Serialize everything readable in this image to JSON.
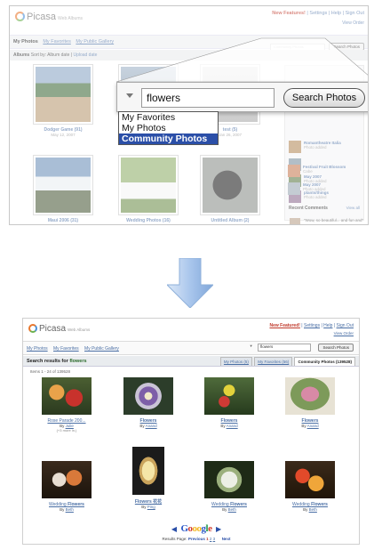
{
  "top": {
    "logo_text": "Picasa",
    "logo_sub": "Web Albums",
    "top_links": [
      "New Features!",
      "Settings",
      "Help",
      "Sign Out"
    ],
    "view_order": "View Order",
    "nav_current": "My Photos",
    "nav_links": [
      "My Favorites",
      "My Public Gallery"
    ],
    "search_placeholder": "Community Photos",
    "search_button": "Search Photos",
    "sort_prefix": "Albums",
    "sort_label": "Sort by: Album date",
    "sort_link": "Upload date",
    "albums": [
      {
        "title": "Dodger Game",
        "count": "(91)",
        "date": "May 12, 2007"
      },
      {
        "title": "",
        "count": "",
        "date": ""
      },
      {
        "title": "test",
        "count": "(5)",
        "date": "Jan 26, 2007"
      },
      {
        "title": "Maui 2006",
        "count": "(31)",
        "date": ""
      },
      {
        "title": "Wedding Photos",
        "count": "(16)",
        "date": ""
      },
      {
        "title": "Untitled Album",
        "count": "(2)",
        "date": ""
      }
    ],
    "sidebar_items": [
      {
        "name": "Romantheatre Italia",
        "meta": "Photo added"
      },
      {
        "name": "",
        "meta": ""
      },
      {
        "name": "May 2007",
        "meta": "Photo added"
      },
      {
        "name": "plants/things",
        "meta": "Photo added"
      },
      {
        "name": "Festival Fruit Blossom",
        "meta": "Cabe"
      },
      {
        "name": "May 2007",
        "meta": "Photo added"
      }
    ],
    "recent_comments_label": "Recent Comments",
    "recent_comments_link": "View all",
    "recent_comment_text": "\"Wow, so beautiful... and fun and\""
  },
  "zoom": {
    "query": "flowers",
    "button": "Search Photos",
    "dropdown_options": [
      "My Favorites",
      "My Photos",
      "Community Photos"
    ],
    "dropdown_selected": "Community Photos"
  },
  "bottom": {
    "logo_text": "Picasa",
    "logo_sub": "Web Albums",
    "top_links": [
      "New Featured!",
      "Settings",
      "Help",
      "Sign Out"
    ],
    "view_order": "View Order",
    "nav_links": [
      "My Photos",
      "My Favorites",
      "My Public Gallery"
    ],
    "search_value": "flowers",
    "search_button": "Search Photos",
    "results_title_prefix": "Search results for",
    "results_query": "flowers",
    "tabs": [
      {
        "label": "My Photos (5)",
        "active": false
      },
      {
        "label": "My Favorites (56)",
        "active": false
      },
      {
        "label": "Community Photos (139528)",
        "active": true
      }
    ],
    "items_range": "Items 1 - 24 of 139528",
    "results": [
      {
        "name_plain": "Rose Parade 200...",
        "name_bold": "",
        "by_prefix": "By",
        "author": "Julie",
        "extra": "(+3 more in.)"
      },
      {
        "name_plain": "",
        "name_bold": "Flowers",
        "by_prefix": "By",
        "author": "Anand",
        "extra": ""
      },
      {
        "name_plain": "",
        "name_bold": "Flowers",
        "by_prefix": "By",
        "author": "Anand",
        "extra": ""
      },
      {
        "name_plain": "",
        "name_bold": "Flowers",
        "by_prefix": "By",
        "author": "Anand",
        "extra": ""
      },
      {
        "name_plain": "Wedding ",
        "name_bold": "Flowers",
        "by_prefix": "By",
        "author": "Beth",
        "extra": ""
      },
      {
        "name_plain": "",
        "name_bold": "Flowers 花花",
        "by_prefix": "By",
        "author": "Ping",
        "extra": ""
      },
      {
        "name_plain": "Wedding ",
        "name_bold": "Flowers",
        "by_prefix": "By",
        "author": "Beth",
        "extra": ""
      },
      {
        "name_plain": "Wedding ",
        "name_bold": "Flowers",
        "by_prefix": "By",
        "author": "Beth",
        "extra": ""
      }
    ],
    "pager": {
      "logo": "Gooogle",
      "label": "Results Page:",
      "previous": "Previous",
      "pages": [
        "1",
        "2",
        "3"
      ],
      "current_page": "1",
      "next": "Next"
    }
  },
  "colors": {
    "link": "#4a6fa5",
    "accent_red": "#c0392b",
    "selected_blue": "#2b4fa8",
    "arrow_blue": "#8fb4e3"
  }
}
